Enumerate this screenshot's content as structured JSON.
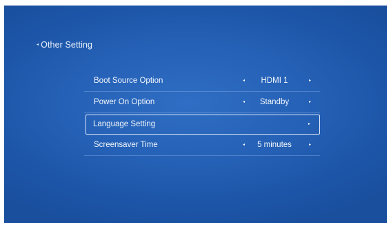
{
  "header": {
    "back_arrow": "◂",
    "title": "Other Setting"
  },
  "menu": {
    "items": [
      {
        "label": "Boot Source Option",
        "value": "HDMI 1",
        "left_arrow": "◂",
        "right_arrow": "▸"
      },
      {
        "label": "Power On Option",
        "value": "Standby",
        "left_arrow": "◂",
        "right_arrow": "▸"
      },
      {
        "label": "Language Setting",
        "right_arrow": "▸",
        "selected": true
      },
      {
        "label": "Screensaver Time",
        "value": "5 minutes",
        "left_arrow": "◂",
        "right_arrow": "▸"
      }
    ]
  },
  "colors": {
    "background": "#2561b6",
    "text": "#f2f6fc",
    "highlight_border": "#dfeaf8"
  }
}
